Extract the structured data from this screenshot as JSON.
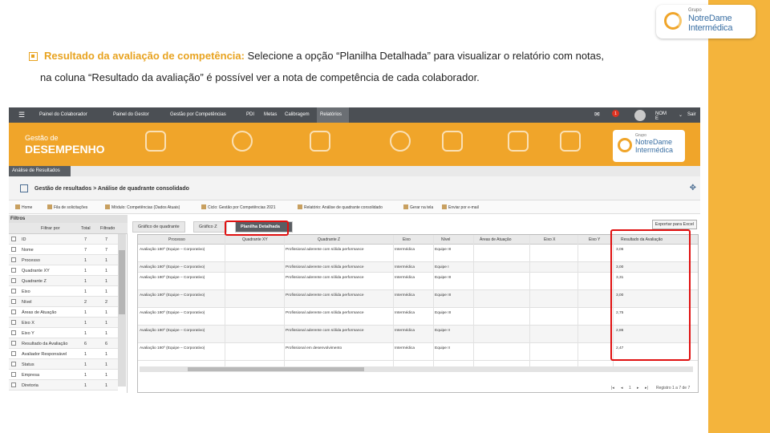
{
  "brand": {
    "small": "Grupo",
    "line1": "NotreDame",
    "line2": "Intermédica"
  },
  "instruction": {
    "highlight": "Resultado da avaliação de competência:",
    "text1": " Selecione a opção “Planilha Detalhada” para visualizar o relatório com notas,",
    "text2": "na coluna “Resultado da avaliação” é possível ver a nota de competência de cada colaborador."
  },
  "app": {
    "nav": {
      "items": [
        "Painel do Colaborador",
        "Painel do Gestor",
        "Gestão por Competências",
        "PDI",
        "Metas",
        "Calibragem",
        "Relatórios"
      ],
      "user": "NOM E",
      "exit": "Sair",
      "badge": "1"
    },
    "hero": {
      "line1": "Gestão de",
      "line2": "DESEMPENHO"
    },
    "subtab": "Análise de Resultados",
    "breadcrumb": "Gestão de resultados > Análise de quadrante consolidado",
    "toolbar": [
      "Home",
      "Fila de solicitações",
      "Módulo: Competências (Dados Atuais)",
      "Ciclo: Gestão por Competências 2021",
      "Relatório: Análise de quadrante consolidado",
      "Gerar na tela",
      "Enviar por e-mail"
    ],
    "filters": {
      "title": "Filtros",
      "headers": [
        "Filtrar por",
        "Total",
        "Filtrado"
      ],
      "rows": [
        {
          "name": "ID",
          "total": "7",
          "filt": "7"
        },
        {
          "name": "Nome",
          "total": "7",
          "filt": "7"
        },
        {
          "name": "Processo",
          "total": "1",
          "filt": "1"
        },
        {
          "name": "Quadrante XY",
          "total": "1",
          "filt": "1"
        },
        {
          "name": "Quadrante Z",
          "total": "1",
          "filt": "1"
        },
        {
          "name": "Eixo",
          "total": "1",
          "filt": "1"
        },
        {
          "name": "Nível",
          "total": "2",
          "filt": "2"
        },
        {
          "name": "Áreas de Atuação",
          "total": "1",
          "filt": "1"
        },
        {
          "name": "Eixo X",
          "total": "1",
          "filt": "1"
        },
        {
          "name": "Eixo Y",
          "total": "1",
          "filt": "1"
        },
        {
          "name": "Resultado da Avaliação",
          "total": "6",
          "filt": "6"
        },
        {
          "name": "Avaliador Responsável",
          "total": "1",
          "filt": "1"
        },
        {
          "name": "Status",
          "total": "1",
          "filt": "1"
        },
        {
          "name": "Empresa",
          "total": "1",
          "filt": "1"
        },
        {
          "name": "Diretoria",
          "total": "1",
          "filt": "1"
        }
      ]
    },
    "tabs": [
      "Gráfico de quadrante",
      "Gráfico Z",
      "Planilha Detalhada"
    ],
    "export": "Exportar para Excel",
    "grid": {
      "headers": [
        "Processo",
        "Quadrante XY",
        "Quadrante Z",
        "Eixo",
        "Nível",
        "Áreas de Atuação",
        "Eixo X",
        "Eixo Y",
        "Resultado da Avaliação"
      ],
      "rows": [
        {
          "proc": "Avaliação 180º (Equipe – Corporativo)",
          "qz": "Profissional aderente com sólida performance",
          "eixo": "Intermédica",
          "nivel": "Equipe III",
          "res": "3,06"
        },
        {
          "proc": "Avaliação 180º (Equipe – Corporativo)",
          "qz": "Profissional aderente com sólida performance",
          "eixo": "Intermédica",
          "nivel": "Equipe I",
          "res": "3,00"
        },
        {
          "proc": "Avaliação 180º (Equipe – Corporativo)",
          "qz": "Profissional aderente com sólida performance",
          "eixo": "Intermédica",
          "nivel": "Equipe III",
          "res": "3,31"
        },
        {
          "proc": "Avaliação 180º (Equipe – Corporativo)",
          "qz": "Profissional aderente com sólida performance",
          "eixo": "Intermédica",
          "nivel": "Equipe III",
          "res": "3,00"
        },
        {
          "proc": "Avaliação 180º (Equipe – Corporativo)",
          "qz": "Profissional aderente com sólida performance",
          "eixo": "Intermédica",
          "nivel": "Equipe III",
          "res": "2,75"
        },
        {
          "proc": "Avaliação 180º (Equipe – Corporativo)",
          "qz": "Profissional aderente com sólida performance",
          "eixo": "Intermédica",
          "nivel": "Equipe II",
          "res": "2,86"
        },
        {
          "proc": "Avaliação 180º (Equipe – Corporativo)",
          "qz": "Profissional em desenvolvimento",
          "eixo": "Intermédica",
          "nivel": "Equipe II",
          "res": "2,47"
        }
      ],
      "pager": {
        "page": "1",
        "summary": "Registro 1 a 7 de 7"
      }
    }
  }
}
